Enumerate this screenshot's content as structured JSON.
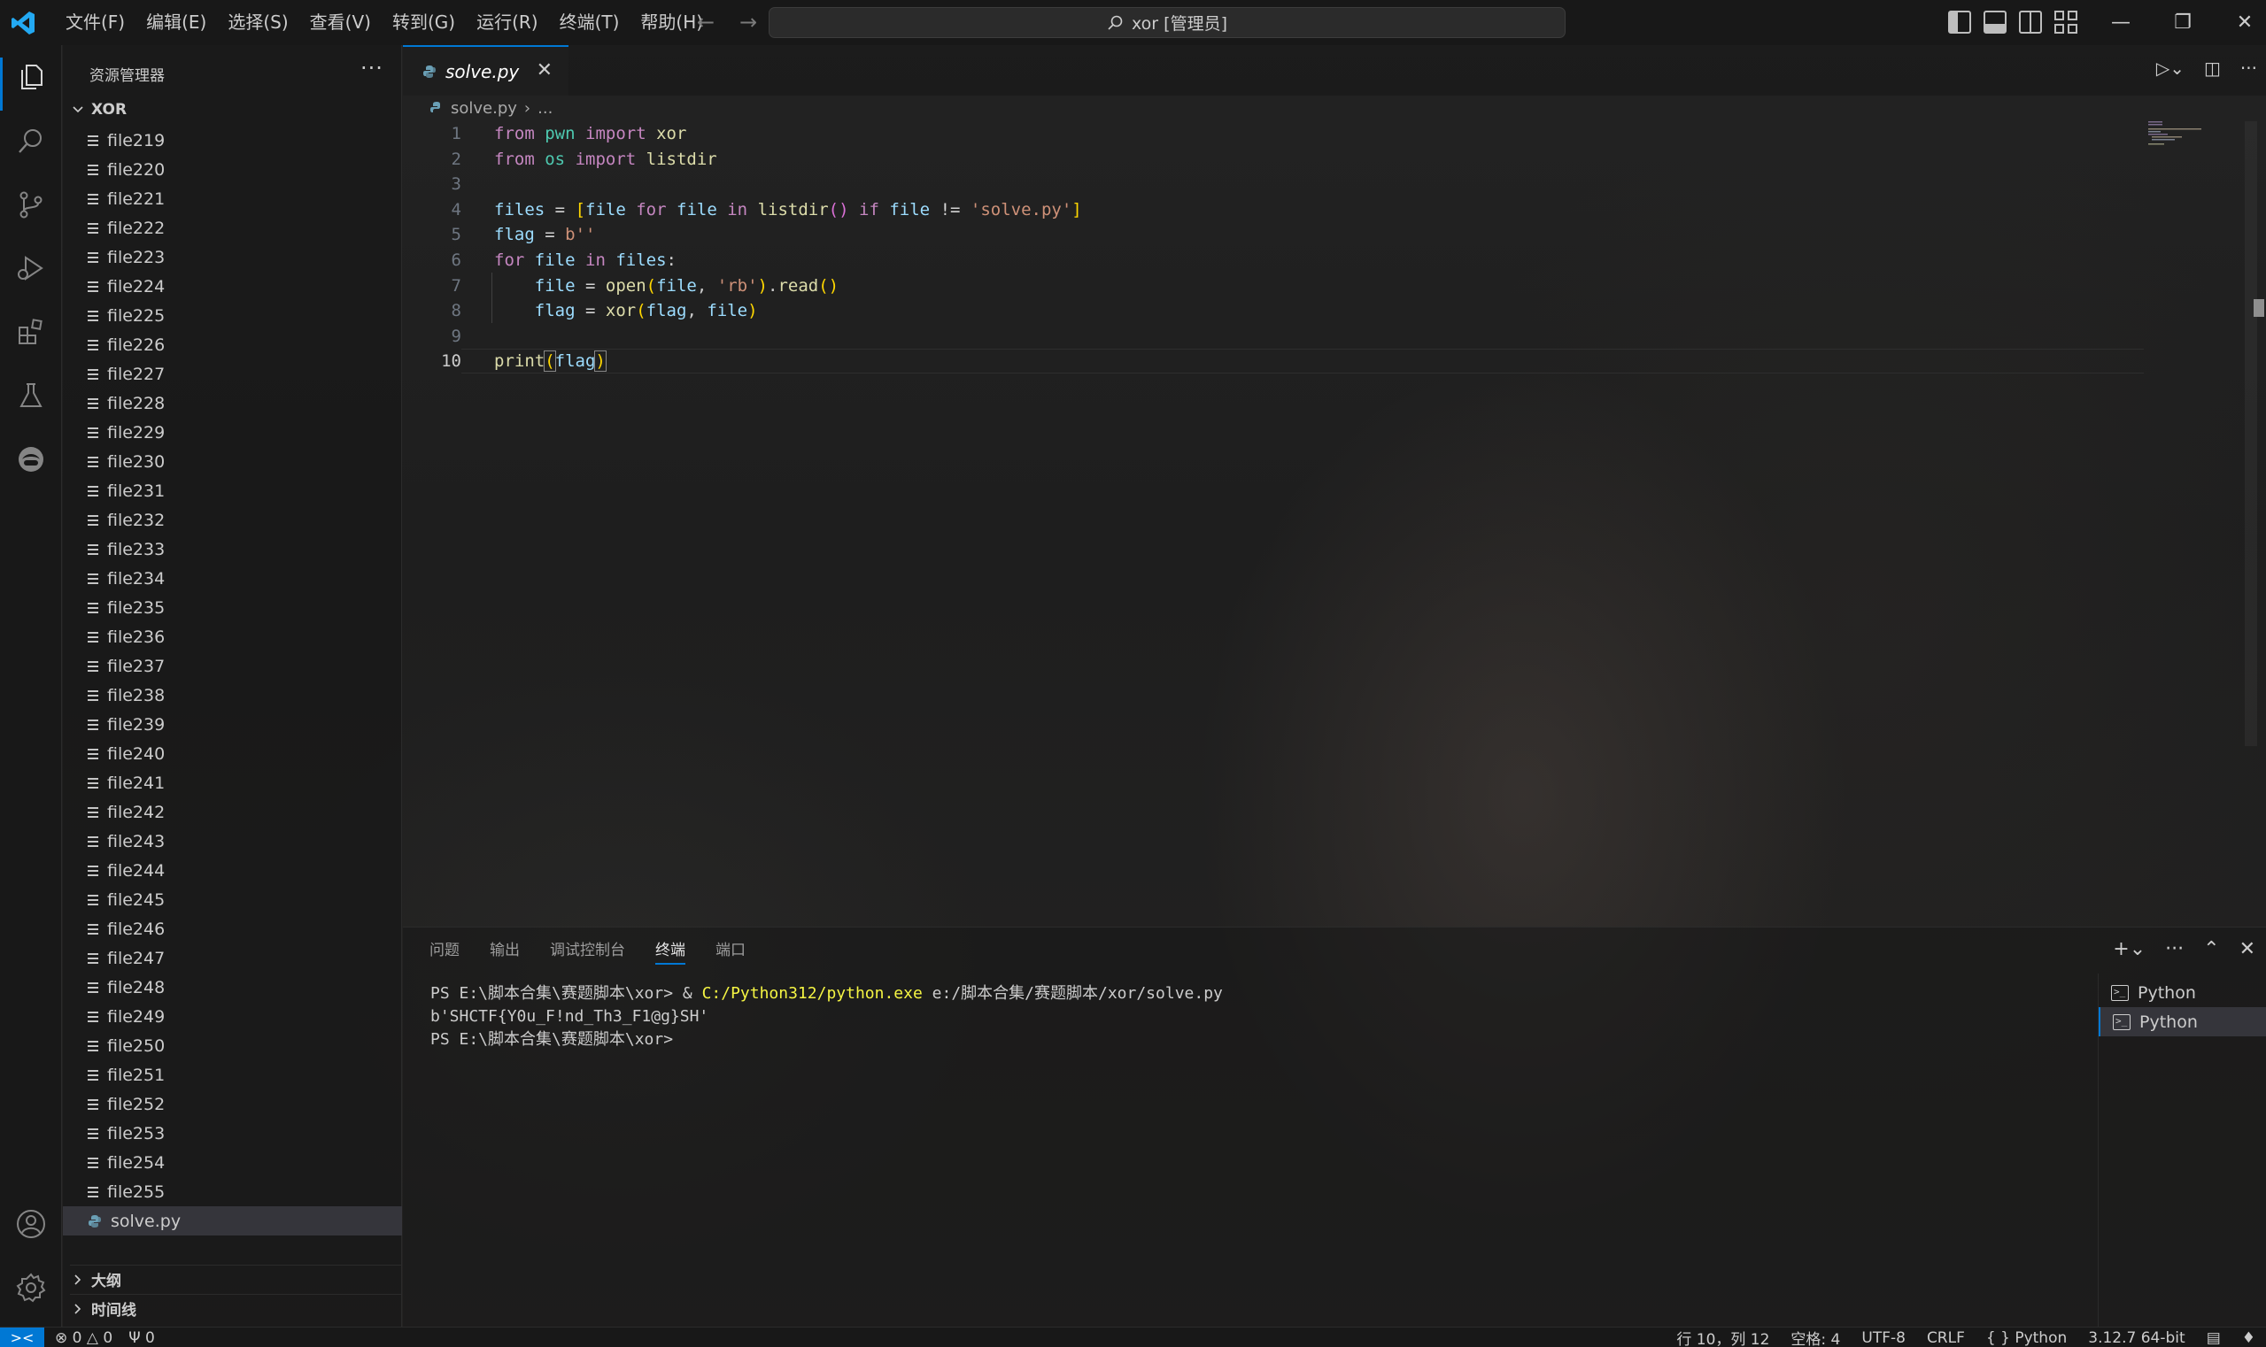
{
  "titlebar": {
    "menu": [
      "文件(F)",
      "编辑(E)",
      "选择(S)",
      "查看(V)",
      "转到(G)",
      "运行(R)",
      "终端(T)",
      "帮助(H)"
    ],
    "search_text": "xor [管理员]"
  },
  "sidebar": {
    "title": "资源管理器",
    "folder": "XOR",
    "files": [
      "file219",
      "file220",
      "file221",
      "file222",
      "file223",
      "file224",
      "file225",
      "file226",
      "file227",
      "file228",
      "file229",
      "file230",
      "file231",
      "file232",
      "file233",
      "file234",
      "file235",
      "file236",
      "file237",
      "file238",
      "file239",
      "file240",
      "file241",
      "file242",
      "file243",
      "file244",
      "file245",
      "file246",
      "file247",
      "file248",
      "file249",
      "file250",
      "file251",
      "file252",
      "file253",
      "file254",
      "file255"
    ],
    "selected_file": "solve.py",
    "outline": "大纲",
    "timeline": "时间线"
  },
  "editor": {
    "tab_label": "solve.py",
    "breadcrumb_file": "solve.py",
    "breadcrumb_more": "...",
    "line_numbers": [
      "1",
      "2",
      "3",
      "4",
      "5",
      "6",
      "7",
      "8",
      "9",
      "10"
    ],
    "active_line": "10"
  },
  "panel": {
    "tabs": [
      "问题",
      "输出",
      "调试控制台",
      "终端",
      "端口"
    ],
    "active_tab": "终端",
    "terminal": {
      "line1_prompt": "PS E:\\脚本合集\\赛题脚本\\xor> & ",
      "line1_exe": "C:/Python312/python.exe",
      "line1_arg": " e:/脚本合集/赛题脚本/xor/solve.py",
      "line2": "b'SHCTF{Y0u_F!nd_Th3_F1@g}SH'",
      "line3": "PS E:\\脚本合集\\赛题脚本\\xor> "
    },
    "terminal_instances": [
      "Python",
      "Python"
    ]
  },
  "statusbar": {
    "errors": "0",
    "warnings": "0",
    "ports": "0",
    "position": "行 10，列 12",
    "spaces": "空格: 4",
    "encoding": "UTF-8",
    "eol": "CRLF",
    "language": "Python",
    "interpreter": "3.12.7 64-bit"
  },
  "colors": {
    "accent": "#0078d4",
    "keyword": "#c586c0",
    "module": "#4ec9b0",
    "variable": "#9cdcfe",
    "function": "#dcdcaa",
    "string": "#ce9178"
  }
}
